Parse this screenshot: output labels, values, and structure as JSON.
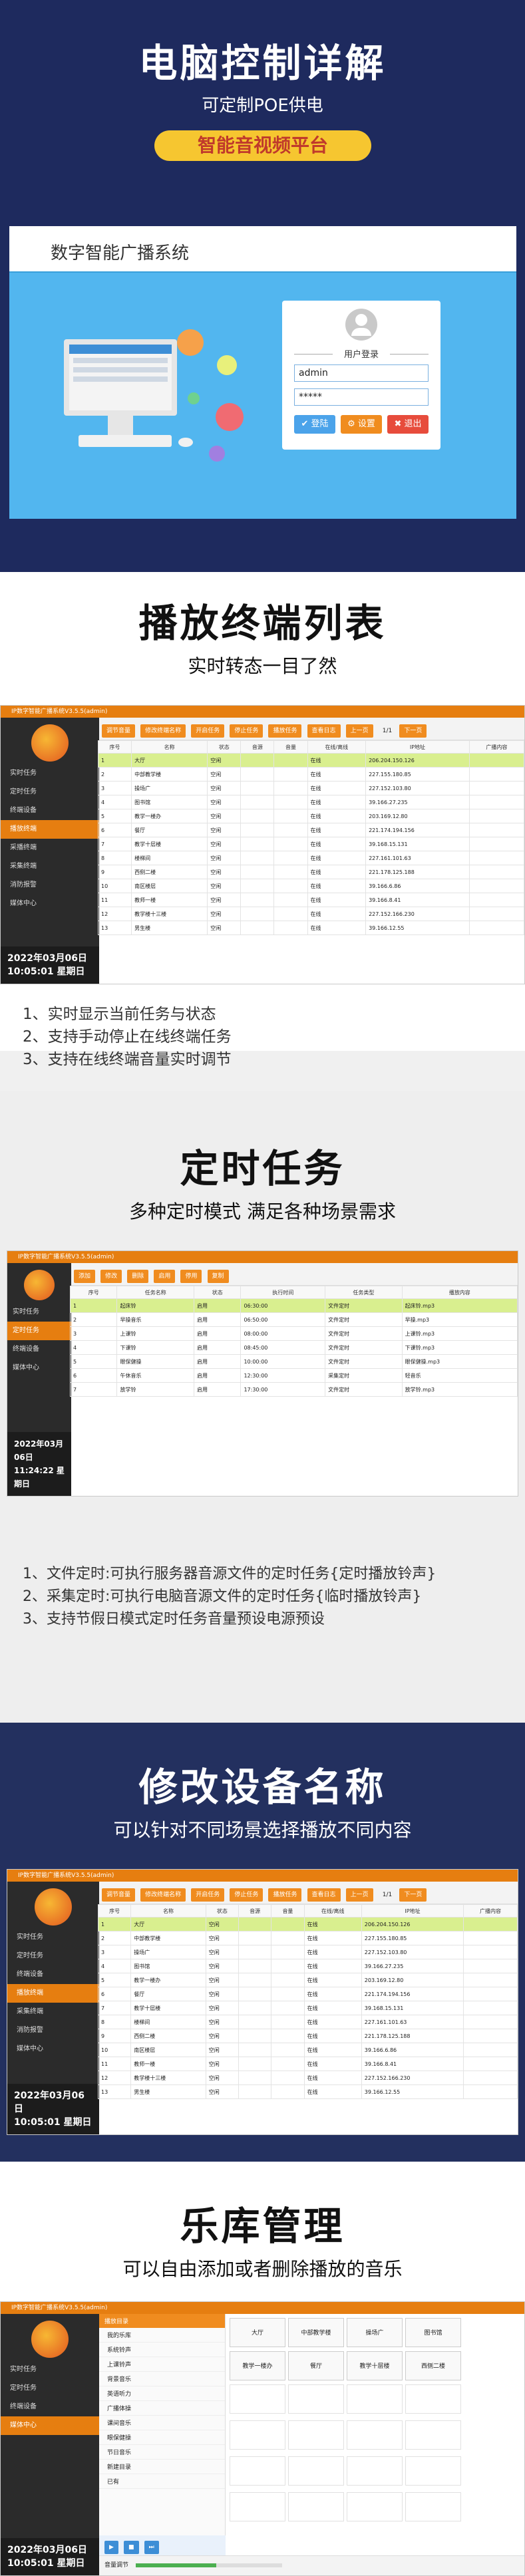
{
  "hero": {
    "title": "电脑控制详解",
    "subtitle": "可定制POE供电",
    "badge": "智能音视频平台",
    "system_title": "数字智能广播系统",
    "login": {
      "title": "用户登录",
      "username_value": "admin",
      "password_value": "*****",
      "login_label": "登陆",
      "settings_label": "设置",
      "exit_label": "退出"
    }
  },
  "section1": {
    "title": "播放终端列表",
    "subtitle": "实时转态一目了然",
    "features": [
      "1、实时显示当前任务与状态",
      "2、支持手动停止在线终端任务",
      "3、支持在线终端音量实时调节"
    ]
  },
  "section2": {
    "title": "定时任务",
    "subtitle": "多种定时模式 满足各种场景需求",
    "features": [
      "1、文件定时:可执行服务器音源文件的定时任务{定时播放铃声}",
      "2、采集定时:可执行电脑音源文件的定时任务{临时播放铃声}",
      "3、支持节假日模式定时任务音量预设电源预设"
    ]
  },
  "section3": {
    "title": "修改设备名称",
    "subtitle": "可以针对不同场景选择播放不同内容"
  },
  "section4": {
    "title": "乐库管理",
    "subtitle": "可以自由添加或者删除播放的音乐"
  },
  "app": {
    "window_title": "IP数字智能广播系统V3.5.5(admin)",
    "sidebar": [
      "实时任务",
      "定时任务",
      "终端设备",
      "播放终端",
      "采播终端",
      "采集终端",
      "消防报警",
      "媒体中心"
    ],
    "clock_date": "2022年03月06日",
    "clock_time": "10:05:01",
    "clock_weekday": "星期日",
    "clock2_time": "11:24:22",
    "toolbar": [
      "调节音量",
      "修改终端名称",
      "开启任务",
      "停止任务",
      "播放任务",
      "查看日志",
      "上一页",
      "下一页"
    ],
    "page_num": "1/1",
    "columns": [
      "序号",
      "名称",
      "状态",
      "音源",
      "音量",
      "在线/离线",
      "IP地址",
      "广播内容"
    ],
    "rows": [
      {
        "no": "1",
        "name": "大厅",
        "state": "空闲",
        "source": "",
        "volume": "",
        "online": "在线",
        "ip": "206.204.150.126",
        "content": ""
      },
      {
        "no": "2",
        "name": "中部教学楼",
        "state": "空闲",
        "source": "",
        "volume": "",
        "online": "在线",
        "ip": "227.155.180.85",
        "content": ""
      },
      {
        "no": "3",
        "name": "操场广",
        "state": "空闲",
        "source": "",
        "volume": "",
        "online": "在线",
        "ip": "227.152.103.80",
        "content": ""
      },
      {
        "no": "4",
        "name": "图书馆",
        "state": "空闲",
        "source": "",
        "volume": "",
        "online": "在线",
        "ip": "39.166.27.235",
        "content": ""
      },
      {
        "no": "5",
        "name": "教学一楼办",
        "state": "空闲",
        "source": "",
        "volume": "",
        "online": "在线",
        "ip": "203.169.12.80",
        "content": ""
      },
      {
        "no": "6",
        "name": "餐厅",
        "state": "空闲",
        "source": "",
        "volume": "",
        "online": "在线",
        "ip": "221.174.194.156",
        "content": ""
      },
      {
        "no": "7",
        "name": "教学十层楼",
        "state": "空闲",
        "source": "",
        "volume": "",
        "online": "在线",
        "ip": "39.168.15.131",
        "content": ""
      },
      {
        "no": "8",
        "name": "楼梯间",
        "state": "空闲",
        "source": "",
        "volume": "",
        "online": "在线",
        "ip": "227.161.101.63",
        "content": ""
      },
      {
        "no": "9",
        "name": "西侧二楼",
        "state": "空闲",
        "source": "",
        "volume": "",
        "online": "在线",
        "ip": "221.178.125.188",
        "content": ""
      },
      {
        "no": "10",
        "name": "南区楼层",
        "state": "空闲",
        "source": "",
        "volume": "",
        "online": "在线",
        "ip": "39.166.6.86",
        "content": ""
      },
      {
        "no": "11",
        "name": "教师一楼",
        "state": "空闲",
        "source": "",
        "volume": "",
        "online": "在线",
        "ip": "39.166.8.41",
        "content": ""
      },
      {
        "no": "12",
        "name": "教学楼十三楼",
        "state": "空闲",
        "source": "",
        "volume": "",
        "online": "在线",
        "ip": "227.152.166.230",
        "content": ""
      },
      {
        "no": "13",
        "name": "男生楼",
        "state": "空闲",
        "source": "",
        "volume": "",
        "online": "在线",
        "ip": "39.166.12.55",
        "content": ""
      }
    ],
    "task_toolbar": [
      "添加",
      "修改",
      "删除",
      "启用",
      "停用",
      "复制"
    ],
    "task_columns": [
      "序号",
      "任务名称",
      "状态",
      "执行时间",
      "任务类型",
      "播放内容"
    ],
    "task_rows": [
      {
        "no": "1",
        "name": "起床铃",
        "state": "启用",
        "time": "06:30:00",
        "type": "文件定时",
        "content": "起床铃.mp3"
      },
      {
        "no": "2",
        "name": "早操音乐",
        "state": "启用",
        "time": "06:50:00",
        "type": "文件定时",
        "content": "早操.mp3"
      },
      {
        "no": "3",
        "name": "上课铃",
        "state": "启用",
        "time": "08:00:00",
        "type": "文件定时",
        "content": "上课铃.mp3"
      },
      {
        "no": "4",
        "name": "下课铃",
        "state": "启用",
        "time": "08:45:00",
        "type": "文件定时",
        "content": "下课铃.mp3"
      },
      {
        "no": "5",
        "name": "眼保健操",
        "state": "启用",
        "time": "10:00:00",
        "type": "文件定时",
        "content": "眼保健操.mp3"
      },
      {
        "no": "6",
        "name": "午休音乐",
        "state": "启用",
        "time": "12:30:00",
        "type": "采集定时",
        "content": "轻音乐"
      },
      {
        "no": "7",
        "name": "放学铃",
        "state": "启用",
        "time": "17:30:00",
        "type": "文件定时",
        "content": "放学铃.mp3"
      }
    ],
    "library_title": "播放目录",
    "library_tree": [
      "我的乐库",
      "系统铃声",
      "上课铃声",
      "背景音乐",
      "英语听力",
      "广播体操",
      "课间音乐",
      "眼保健操",
      "节日音乐",
      "新建目录",
      "已有"
    ],
    "library_grid": [
      "大厅",
      "中部教学楼",
      "操场广",
      "图书馆",
      "教学一楼办",
      "餐厅",
      "教学十层楼",
      "西侧二楼"
    ],
    "volume_label": "音量调节"
  }
}
